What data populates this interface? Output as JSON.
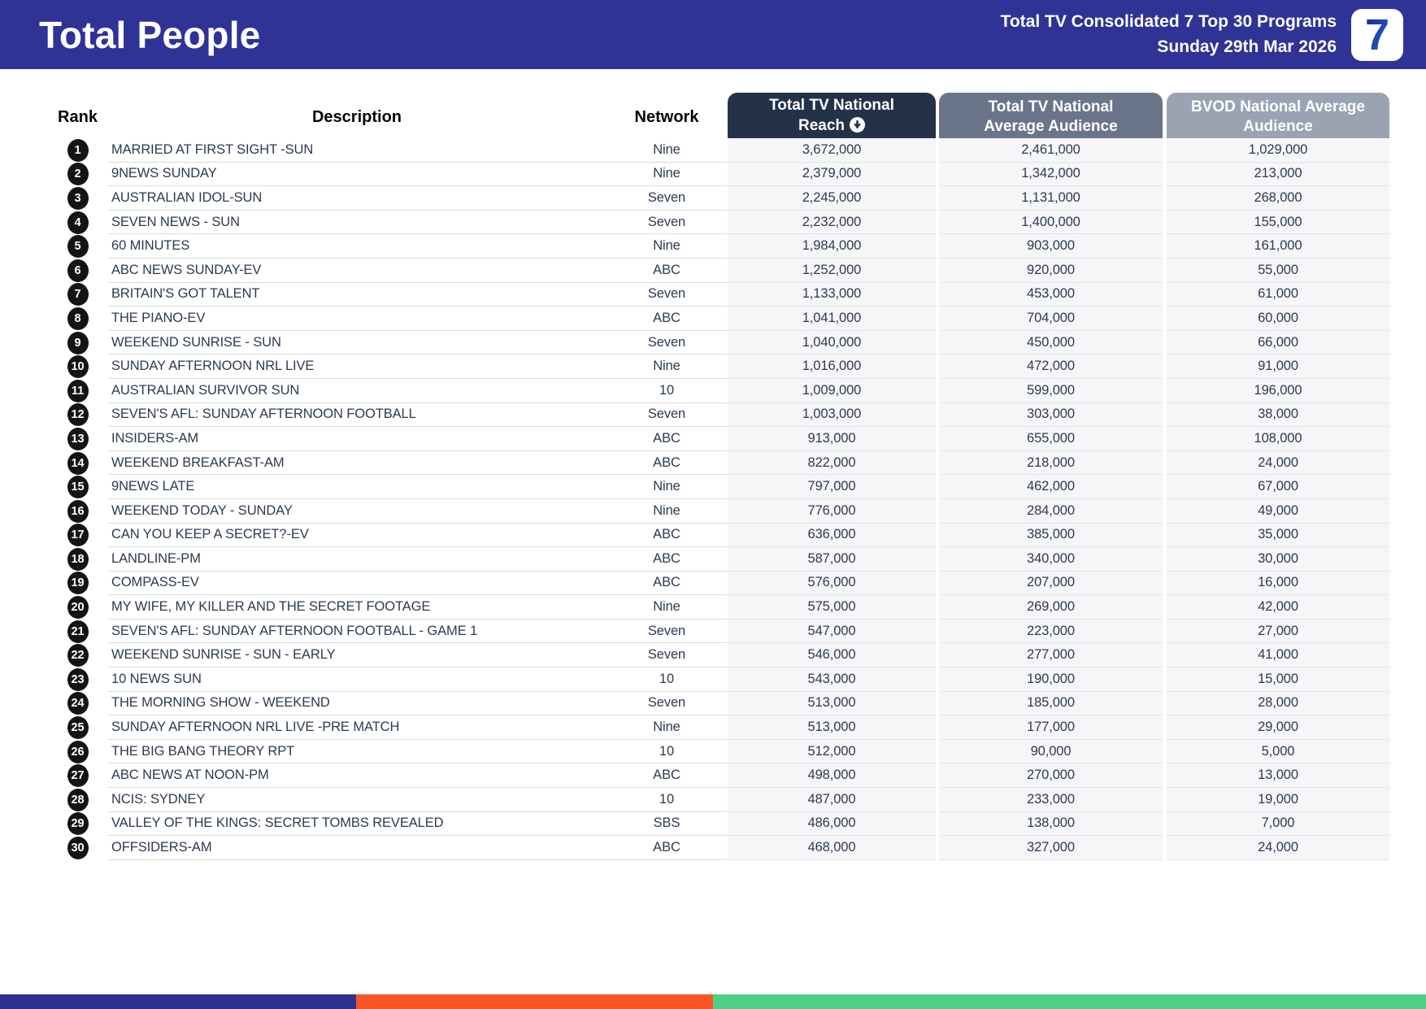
{
  "header": {
    "title": "Total People",
    "subtitle_line1": "Total TV Consolidated 7 Top 30 Programs",
    "subtitle_line2": "Sunday 29th Mar 2026",
    "logo_text": "7"
  },
  "colors": {
    "banner_blue": "#2F3396",
    "header_reach_dark": "#243249",
    "header_avg_medium": "#6B7589",
    "header_bvod_light": "#9AA3B1",
    "body_text": "#2B3A52",
    "footer_segments": [
      "#2E3192",
      "#FB5426",
      "#52CF87"
    ]
  },
  "chart_data": {
    "type": "table",
    "title": "Total People",
    "subtitle": "Total TV Consolidated 7 Top 30 Programs — Sunday 29th Mar 2026",
    "sort": {
      "column": "Total TV National Reach",
      "direction": "descending",
      "icon": "circle-arrow-down"
    },
    "columns": [
      {
        "key": "rank",
        "label": "Rank",
        "style": "plain"
      },
      {
        "key": "description",
        "label": "Description",
        "style": "plain"
      },
      {
        "key": "network",
        "label": "Network",
        "style": "plain"
      },
      {
        "key": "reach",
        "label": "Total TV National Reach",
        "style": "button-dark",
        "sorted": true
      },
      {
        "key": "avg_audience",
        "label": "Total TV National Average Audience",
        "style": "button-medium"
      },
      {
        "key": "bvod_audience",
        "label": "BVOD National Average Audience",
        "style": "button-light"
      }
    ],
    "rows": [
      [
        1,
        "MARRIED AT FIRST SIGHT -SUN",
        "Nine",
        "3,672,000",
        "2,461,000",
        "1,029,000"
      ],
      [
        2,
        "9NEWS SUNDAY",
        "Nine",
        "2,379,000",
        "1,342,000",
        "213,000"
      ],
      [
        3,
        "AUSTRALIAN IDOL-SUN",
        "Seven",
        "2,245,000",
        "1,131,000",
        "268,000"
      ],
      [
        4,
        "SEVEN NEWS - SUN",
        "Seven",
        "2,232,000",
        "1,400,000",
        "155,000"
      ],
      [
        5,
        "60 MINUTES",
        "Nine",
        "1,984,000",
        "903,000",
        "161,000"
      ],
      [
        6,
        "ABC NEWS SUNDAY-EV",
        "ABC",
        "1,252,000",
        "920,000",
        "55,000"
      ],
      [
        7,
        "BRITAIN'S GOT TALENT",
        "Seven",
        "1,133,000",
        "453,000",
        "61,000"
      ],
      [
        8,
        "THE PIANO-EV",
        "ABC",
        "1,041,000",
        "704,000",
        "60,000"
      ],
      [
        9,
        "WEEKEND SUNRISE - SUN",
        "Seven",
        "1,040,000",
        "450,000",
        "66,000"
      ],
      [
        10,
        "SUNDAY AFTERNOON NRL LIVE",
        "Nine",
        "1,016,000",
        "472,000",
        "91,000"
      ],
      [
        11,
        "AUSTRALIAN SURVIVOR SUN",
        "10",
        "1,009,000",
        "599,000",
        "196,000"
      ],
      [
        12,
        "SEVEN'S AFL: SUNDAY AFTERNOON FOOTBALL",
        "Seven",
        "1,003,000",
        "303,000",
        "38,000"
      ],
      [
        13,
        "INSIDERS-AM",
        "ABC",
        "913,000",
        "655,000",
        "108,000"
      ],
      [
        14,
        "WEEKEND BREAKFAST-AM",
        "ABC",
        "822,000",
        "218,000",
        "24,000"
      ],
      [
        15,
        "9NEWS LATE",
        "Nine",
        "797,000",
        "462,000",
        "67,000"
      ],
      [
        16,
        "WEEKEND TODAY - SUNDAY",
        "Nine",
        "776,000",
        "284,000",
        "49,000"
      ],
      [
        17,
        "CAN YOU KEEP A SECRET?-EV",
        "ABC",
        "636,000",
        "385,000",
        "35,000"
      ],
      [
        18,
        "LANDLINE-PM",
        "ABC",
        "587,000",
        "340,000",
        "30,000"
      ],
      [
        19,
        "COMPASS-EV",
        "ABC",
        "576,000",
        "207,000",
        "16,000"
      ],
      [
        20,
        "MY WIFE, MY KILLER AND THE SECRET FOOTAGE",
        "Nine",
        "575,000",
        "269,000",
        "42,000"
      ],
      [
        21,
        "SEVEN'S AFL: SUNDAY AFTERNOON FOOTBALL - GAME 1",
        "Seven",
        "547,000",
        "223,000",
        "27,000"
      ],
      [
        22,
        "WEEKEND SUNRISE - SUN - EARLY",
        "Seven",
        "546,000",
        "277,000",
        "41,000"
      ],
      [
        23,
        "10 NEWS SUN",
        "10",
        "543,000",
        "190,000",
        "15,000"
      ],
      [
        24,
        "THE MORNING SHOW - WEEKEND",
        "Seven",
        "513,000",
        "185,000",
        "28,000"
      ],
      [
        25,
        "SUNDAY AFTERNOON NRL LIVE -PRE MATCH",
        "Nine",
        "513,000",
        "177,000",
        "29,000"
      ],
      [
        26,
        "THE BIG BANG THEORY RPT",
        "10",
        "512,000",
        "90,000",
        "5,000"
      ],
      [
        27,
        "ABC NEWS AT NOON-PM",
        "ABC",
        "498,000",
        "270,000",
        "13,000"
      ],
      [
        28,
        "NCIS: SYDNEY",
        "10",
        "487,000",
        "233,000",
        "19,000"
      ],
      [
        29,
        "VALLEY OF THE KINGS: SECRET TOMBS REVEALED",
        "SBS",
        "486,000",
        "138,000",
        "7,000"
      ],
      [
        30,
        "OFFSIDERS-AM",
        "ABC",
        "468,000",
        "327,000",
        "24,000"
      ]
    ]
  }
}
